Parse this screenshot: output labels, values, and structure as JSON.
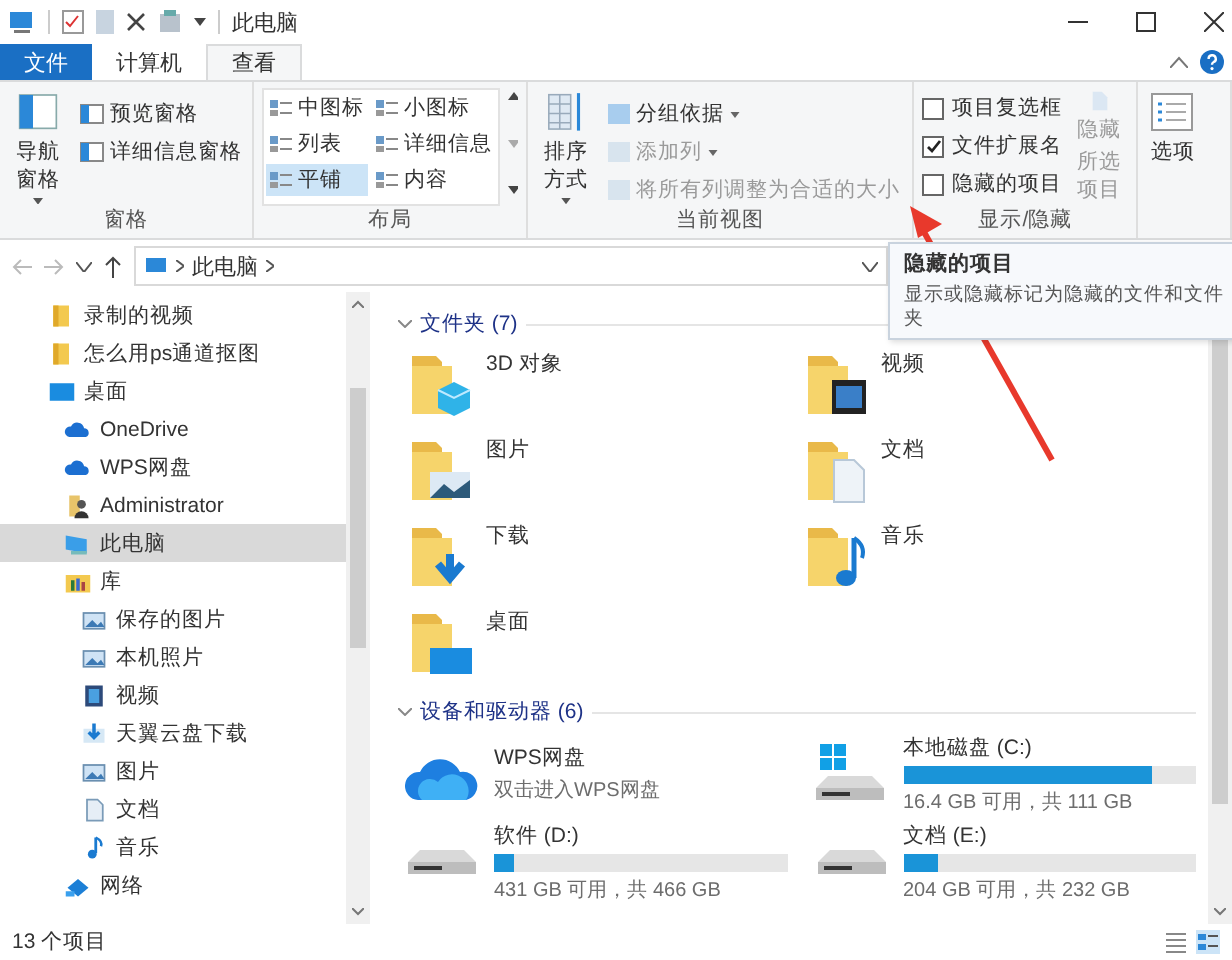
{
  "window": {
    "title": "此电脑"
  },
  "ribbon_tabs": [
    {
      "label": "文件",
      "kind": "file",
      "selected": false
    },
    {
      "label": "计算机",
      "kind": "tab",
      "selected": false
    },
    {
      "label": "查看",
      "kind": "tab",
      "selected": true
    }
  ],
  "ribbon_groups": [
    {
      "kind": "panes",
      "title": "窗格",
      "large": "导航窗格",
      "small": [
        "预览窗格",
        "详细信息窗格"
      ]
    },
    {
      "kind": "layout",
      "title": "布局",
      "options": [
        {
          "label": "中图标",
          "selected": false
        },
        {
          "label": "小图标",
          "selected": false
        },
        {
          "label": "列表",
          "selected": false
        },
        {
          "label": "详细信息",
          "selected": false
        },
        {
          "label": "平铺",
          "selected": true
        },
        {
          "label": "内容",
          "selected": false
        }
      ]
    },
    {
      "kind": "view",
      "title": "当前视图",
      "large": "排序方式",
      "commands": [
        {
          "label": "分组依据",
          "kind": "menu",
          "disabled": false
        },
        {
          "label": "添加列",
          "kind": "menu",
          "disabled": true
        },
        {
          "label": "将所有列调整为合适的大小",
          "kind": "command",
          "disabled": true
        }
      ]
    },
    {
      "kind": "showhide",
      "title": "显示/隐藏",
      "checkboxes": [
        {
          "label": "项目复选框",
          "checked": false
        },
        {
          "label": "文件扩展名",
          "checked": true
        },
        {
          "label": "隐藏的项目",
          "checked": false
        }
      ],
      "large": [
        "隐藏",
        "所选项目"
      ],
      "large_disabled": true
    },
    {
      "kind": "options",
      "large": "选项"
    }
  ],
  "address": {
    "path": [
      "此电脑"
    ]
  },
  "tooltip": {
    "title": "隐藏的项目",
    "text": "显示或隐藏标记为隐藏的文件和文件夹"
  },
  "sidebar": {
    "items": [
      {
        "label": "录制的视频",
        "kind": "folder",
        "selected": false
      },
      {
        "label": "怎么用ps通道抠图",
        "kind": "folder",
        "selected": false
      },
      {
        "label": "桌面",
        "kind": "desktop",
        "selected": false,
        "children": [
          {
            "label": "OneDrive",
            "kind": "cloud",
            "selected": false
          },
          {
            "label": "WPS网盘",
            "kind": "cloud",
            "selected": false
          },
          {
            "label": "Administrator",
            "kind": "user",
            "selected": false
          },
          {
            "label": "此电脑",
            "kind": "computer",
            "selected": true
          },
          {
            "label": "库",
            "kind": "library",
            "selected": false,
            "children": [
              {
                "label": "保存的图片",
                "kind": "pictures",
                "selected": false
              },
              {
                "label": "本机照片",
                "kind": "pictures",
                "selected": false
              },
              {
                "label": "视频",
                "kind": "video",
                "selected": false
              },
              {
                "label": "天翼云盘下载",
                "kind": "download",
                "selected": false
              },
              {
                "label": "图片",
                "kind": "pictures",
                "selected": false
              },
              {
                "label": "文档",
                "kind": "documents",
                "selected": false
              },
              {
                "label": "音乐",
                "kind": "music",
                "selected": false
              }
            ]
          },
          {
            "label": "网络",
            "kind": "network",
            "selected": false
          }
        ]
      }
    ]
  },
  "folders": {
    "header": "文件夹 (7)",
    "items": [
      {
        "label": "3D 对象",
        "kind": "cube"
      },
      {
        "label": "视频",
        "kind": "video"
      },
      {
        "label": "图片",
        "kind": "pictures"
      },
      {
        "label": "文档",
        "kind": "documents"
      },
      {
        "label": "下载",
        "kind": "download"
      },
      {
        "label": "音乐",
        "kind": "music"
      },
      {
        "label": "桌面",
        "kind": "desktop"
      }
    ]
  },
  "devices": {
    "header": "设备和驱动器 (6)",
    "items": [
      {
        "name": "WPS网盘",
        "kind": "cloud",
        "subtitle": "双击进入WPS网盘"
      },
      {
        "name": "本地磁盘 (C:)",
        "kind": "system",
        "level": 0.85,
        "capacity": "16.4 GB 可用，共 111 GB"
      },
      {
        "name": "软件 (D:)",
        "kind": "drive",
        "level": 0.07,
        "capacity": "431 GB 可用，共 466 GB"
      },
      {
        "name": "文档 (E:)",
        "kind": "drive",
        "level": 0.12,
        "capacity": "204 GB 可用，共 232 GB"
      }
    ]
  },
  "status_bar": {
    "count": "13 个项目"
  }
}
